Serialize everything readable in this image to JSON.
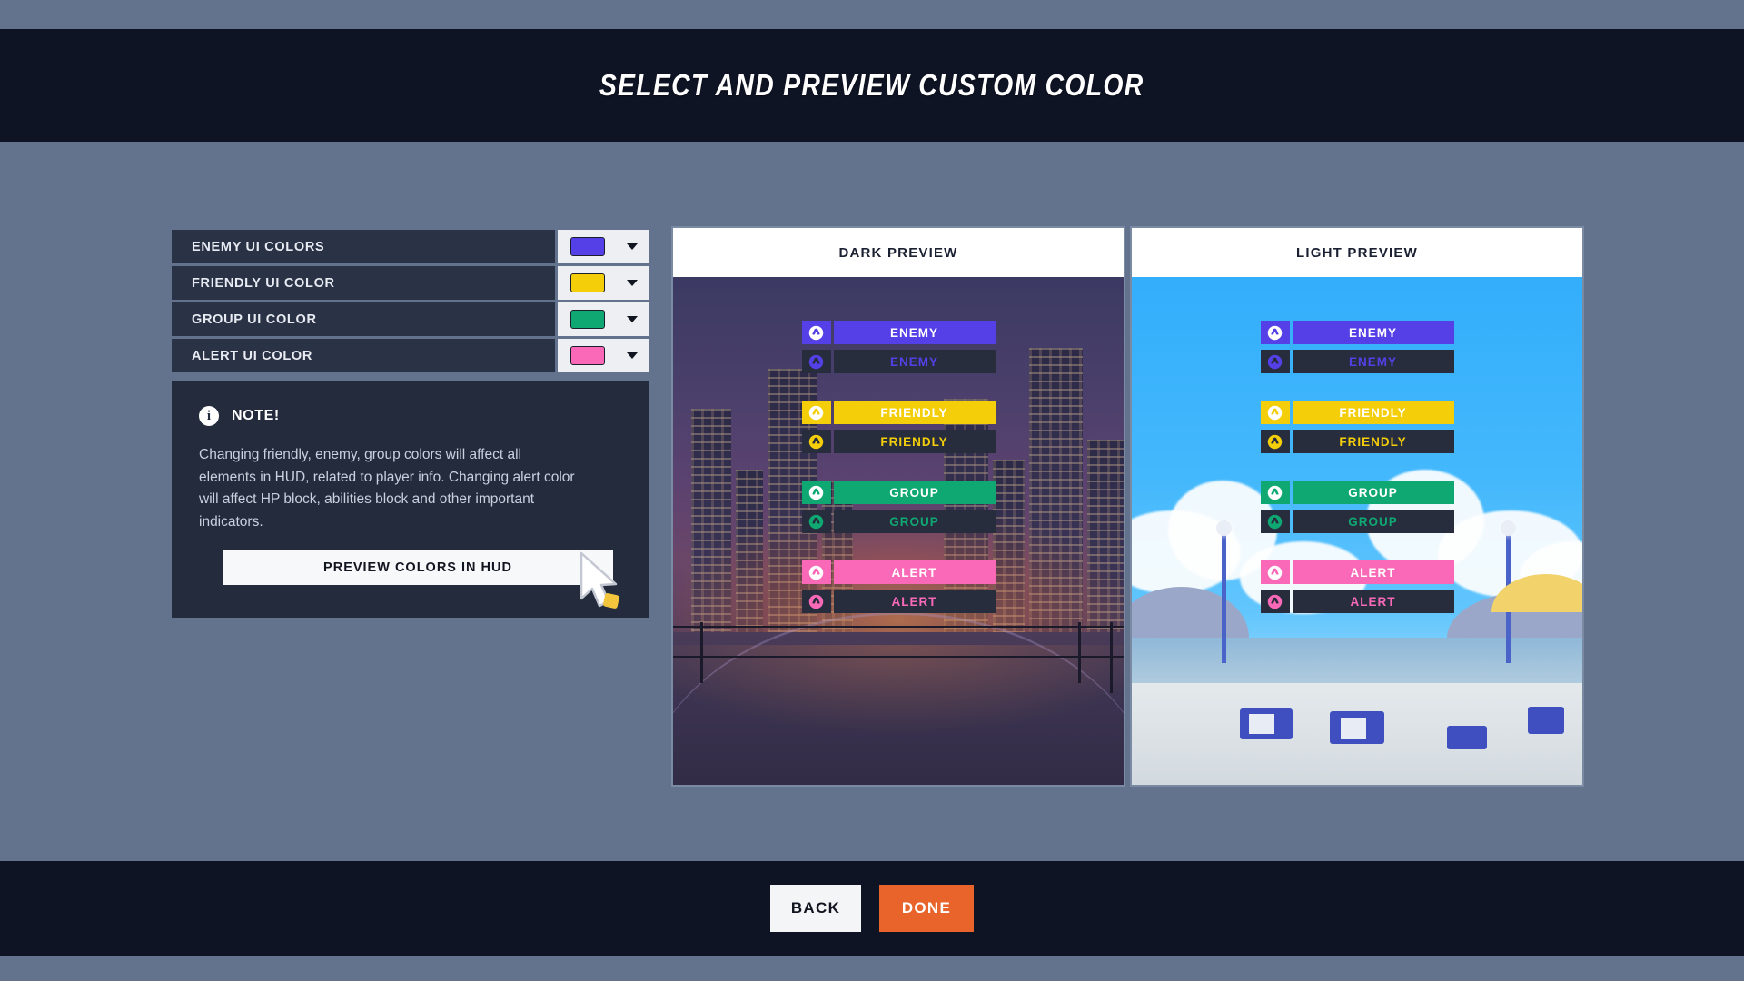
{
  "header": {
    "title": "SELECT AND PREVIEW CUSTOM COLOR"
  },
  "settings": {
    "rows": [
      {
        "label": "ENEMY UI COLORS",
        "color": "#5540E8",
        "icon": "chevron-down-icon"
      },
      {
        "label": "FRIENDLY UI COLOR",
        "color": "#F5CE0A",
        "icon": "chevron-down-icon"
      },
      {
        "label": "GROUP UI COLOR",
        "color": "#0FA873",
        "icon": "chevron-down-icon"
      },
      {
        "label": "ALERT UI COLOR",
        "color": "#F969B8",
        "icon": "chevron-down-icon"
      }
    ]
  },
  "note": {
    "icon": "info-icon",
    "icon_glyph": "i",
    "title": "NOTE!",
    "body": "Changing friendly, enemy, group colors will affect all elements in HUD, related to player info. Changing alert color will affect HP block, abilities block and other important indicators.",
    "preview_button": "PREVIEW COLORS IN HUD"
  },
  "previews": [
    {
      "name": "dark",
      "header": "DARK PREVIEW"
    },
    {
      "name": "light",
      "header": "LIGHT PREVIEW"
    }
  ],
  "hud": {
    "icon_name": "overwatch-logo-icon",
    "groups": [
      {
        "key": "enemy",
        "color": "#5540E8",
        "filled_label": "ENEMY",
        "outline_label": "ENEMY",
        "filled_text": "#FFFFFF",
        "outline_bg": "#272D3D"
      },
      {
        "key": "friendly",
        "color": "#F5CE0A",
        "filled_label": "FRIENDLY",
        "outline_label": "FRIENDLY",
        "filled_text": "#FFFFFF",
        "outline_bg": "#272D3D"
      },
      {
        "key": "group",
        "color": "#0FA873",
        "filled_label": "GROUP",
        "outline_label": "GROUP",
        "filled_text": "#FFFFFF",
        "outline_bg": "#272D3D"
      },
      {
        "key": "alert",
        "color": "#F969B8",
        "filled_label": "ALERT",
        "outline_label": "ALERT",
        "filled_text": "#FFFFFF",
        "outline_bg": "#272D3D"
      }
    ]
  },
  "footer": {
    "back_label": "BACK",
    "done_label": "DONE",
    "done_color": "#E8642A"
  },
  "cursor": {
    "name": "mouse-pointer-cursor"
  },
  "theme": {
    "page_background": "#63738E",
    "band_background": "#0F1425",
    "row_background": "#2A3246",
    "note_background": "#232B3D"
  }
}
